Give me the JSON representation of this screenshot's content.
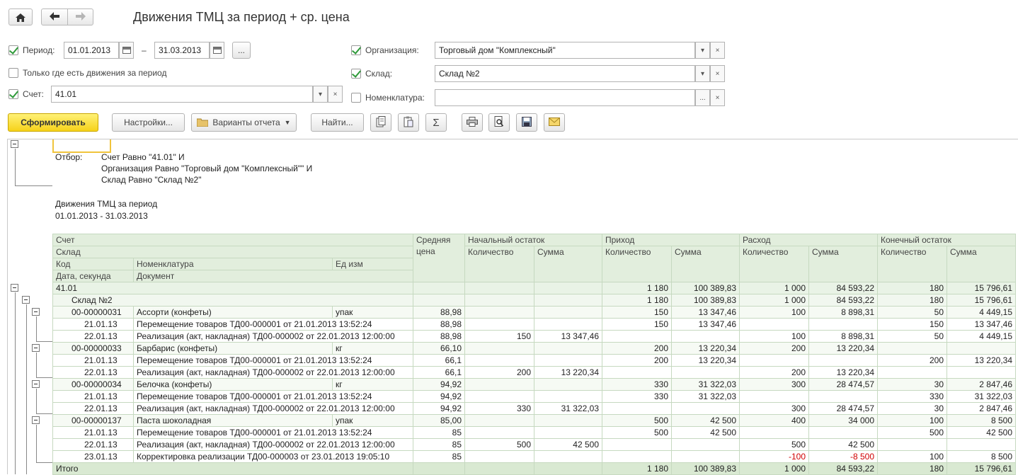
{
  "title": "Движения ТМЦ за период + ср. цена",
  "filters": {
    "period_label": "Период:",
    "period_from": "01.01.2013",
    "period_dash": "–",
    "period_to": "31.03.2013",
    "more_button": "...",
    "only_moves_label": "Только где есть движения за период",
    "account_label": "Счет:",
    "account_value": "41.01",
    "org_label": "Организация:",
    "org_value": "Торговый дом \"Комплексный\"",
    "warehouse_label": "Склад:",
    "warehouse_value": "Склад №2",
    "nomen_label": "Номенклатура:",
    "nomen_value": "",
    "dropdown_glyph": "▾",
    "clear_glyph": "×",
    "dots_glyph": "..."
  },
  "toolbar": {
    "generate": "Сформировать",
    "settings": "Настройки...",
    "variants": "Варианты отчета",
    "find": "Найти...",
    "sum_glyph": "Σ"
  },
  "report": {
    "filter_label": "Отбор:",
    "filter_lines": [
      "Счет Равно \"41.01\" И",
      "Организация Равно \"Торговый дом \"Комплексный\"\" И",
      "Склад Равно \"Склад №2\""
    ],
    "report_title": "Движения ТМЦ за период",
    "report_period": "01.01.2013 - 31.03.2013",
    "headers": {
      "account": "Счет",
      "warehouse": "Склад",
      "code": "Код",
      "nomenclature": "Номенклатура",
      "unit": "Ед изм",
      "date": "Дата, секунда",
      "document": "Документ",
      "avg_price_1": "Средняя",
      "avg_price_2": "цена",
      "opening": "Начальный остаток",
      "income": "Приход",
      "expense": "Расход",
      "closing": "Конечный остаток",
      "qty": "Количество",
      "sum": "Сумма"
    },
    "rows": [
      {
        "kind": "g1",
        "c0": "41.01",
        "c1": "",
        "c2": "",
        "price": "",
        "oq": "",
        "os": "",
        "iq": "1 180",
        "is": "100 389,83",
        "eq": "1 000",
        "es": "84 593,22",
        "cq": "180",
        "cs": "15 796,61"
      },
      {
        "kind": "g2",
        "c0": "Склад №2",
        "c1": "",
        "c2": "",
        "price": "",
        "oq": "",
        "os": "",
        "iq": "1 180",
        "is": "100 389,83",
        "eq": "1 000",
        "es": "84 593,22",
        "cq": "180",
        "cs": "15 796,61"
      },
      {
        "kind": "g3",
        "c0": "00-00000031",
        "c1": "Ассорти (конфеты)",
        "c2": "упак",
        "price": "88,98",
        "oq": "",
        "os": "",
        "iq": "150",
        "is": "13 347,46",
        "eq": "100",
        "es": "8 898,31",
        "cq": "50",
        "cs": "4 449,15"
      },
      {
        "kind": "d",
        "c0": "21.01.13",
        "c1": "Перемещение товаров ТД00-000001 от 21.01.2013 13:52:24",
        "c2": "",
        "price": "88,98",
        "oq": "",
        "os": "",
        "iq": "150",
        "is": "13 347,46",
        "eq": "",
        "es": "",
        "cq": "150",
        "cs": "13 347,46"
      },
      {
        "kind": "d",
        "c0": "22.01.13",
        "c1": "Реализация (акт, накладная) ТД00-000002 от 22.01.2013 12:00:00",
        "c2": "",
        "price": "88,98",
        "oq": "150",
        "os": "13 347,46",
        "iq": "",
        "is": "",
        "eq": "100",
        "es": "8 898,31",
        "cq": "50",
        "cs": "4 449,15"
      },
      {
        "kind": "g3",
        "c0": "00-00000033",
        "c1": "Барбарис (конфеты)",
        "c2": "кг",
        "price": "66,10",
        "oq": "",
        "os": "",
        "iq": "200",
        "is": "13 220,34",
        "eq": "200",
        "es": "13 220,34",
        "cq": "",
        "cs": ""
      },
      {
        "kind": "d",
        "c0": "21.01.13",
        "c1": "Перемещение товаров ТД00-000001 от 21.01.2013 13:52:24",
        "c2": "",
        "price": "66,1",
        "oq": "",
        "os": "",
        "iq": "200",
        "is": "13 220,34",
        "eq": "",
        "es": "",
        "cq": "200",
        "cs": "13 220,34"
      },
      {
        "kind": "d",
        "c0": "22.01.13",
        "c1": "Реализация (акт, накладная) ТД00-000002 от 22.01.2013 12:00:00",
        "c2": "",
        "price": "66,1",
        "oq": "200",
        "os": "13 220,34",
        "iq": "",
        "is": "",
        "eq": "200",
        "es": "13 220,34",
        "cq": "",
        "cs": ""
      },
      {
        "kind": "g3",
        "c0": "00-00000034",
        "c1": "Белочка (конфеты)",
        "c2": "кг",
        "price": "94,92",
        "oq": "",
        "os": "",
        "iq": "330",
        "is": "31 322,03",
        "eq": "300",
        "es": "28 474,57",
        "cq": "30",
        "cs": "2 847,46"
      },
      {
        "kind": "d",
        "c0": "21.01.13",
        "c1": "Перемещение товаров ТД00-000001 от 21.01.2013 13:52:24",
        "c2": "",
        "price": "94,92",
        "oq": "",
        "os": "",
        "iq": "330",
        "is": "31 322,03",
        "eq": "",
        "es": "",
        "cq": "330",
        "cs": "31 322,03"
      },
      {
        "kind": "d",
        "c0": "22.01.13",
        "c1": "Реализация (акт, накладная) ТД00-000002 от 22.01.2013 12:00:00",
        "c2": "",
        "price": "94,92",
        "oq": "330",
        "os": "31 322,03",
        "iq": "",
        "is": "",
        "eq": "300",
        "es": "28 474,57",
        "cq": "30",
        "cs": "2 847,46"
      },
      {
        "kind": "g3",
        "c0": "00-00000137",
        "c1": "Паста шоколадная",
        "c2": "упак",
        "price": "85,00",
        "oq": "",
        "os": "",
        "iq": "500",
        "is": "42 500",
        "eq": "400",
        "es": "34 000",
        "cq": "100",
        "cs": "8 500"
      },
      {
        "kind": "d",
        "c0": "21.01.13",
        "c1": "Перемещение товаров ТД00-000001 от 21.01.2013 13:52:24",
        "c2": "",
        "price": "85",
        "oq": "",
        "os": "",
        "iq": "500",
        "is": "42 500",
        "eq": "",
        "es": "",
        "cq": "500",
        "cs": "42 500"
      },
      {
        "kind": "d",
        "c0": "22.01.13",
        "c1": "Реализация (акт, накладная) ТД00-000002 от 22.01.2013 12:00:00",
        "c2": "",
        "price": "85",
        "oq": "500",
        "os": "42 500",
        "iq": "",
        "is": "",
        "eq": "500",
        "es": "42 500",
        "cq": "",
        "cs": ""
      },
      {
        "kind": "d",
        "neg": true,
        "c0": "23.01.13",
        "c1": "Корректировка реализации ТД00-000003 от 23.01.2013 19:05:10",
        "c2": "",
        "price": "85",
        "oq": "",
        "os": "",
        "iq": "",
        "is": "",
        "eq": "-100",
        "es": "-8 500",
        "cq": "100",
        "cs": "8 500"
      },
      {
        "kind": "tot",
        "c0": "Итого",
        "c1": "",
        "c2": "",
        "price": "",
        "oq": "",
        "os": "",
        "iq": "1 180",
        "is": "100 389,83",
        "eq": "1 000",
        "es": "84 593,22",
        "cq": "180",
        "cs": "15 796,61"
      }
    ]
  }
}
